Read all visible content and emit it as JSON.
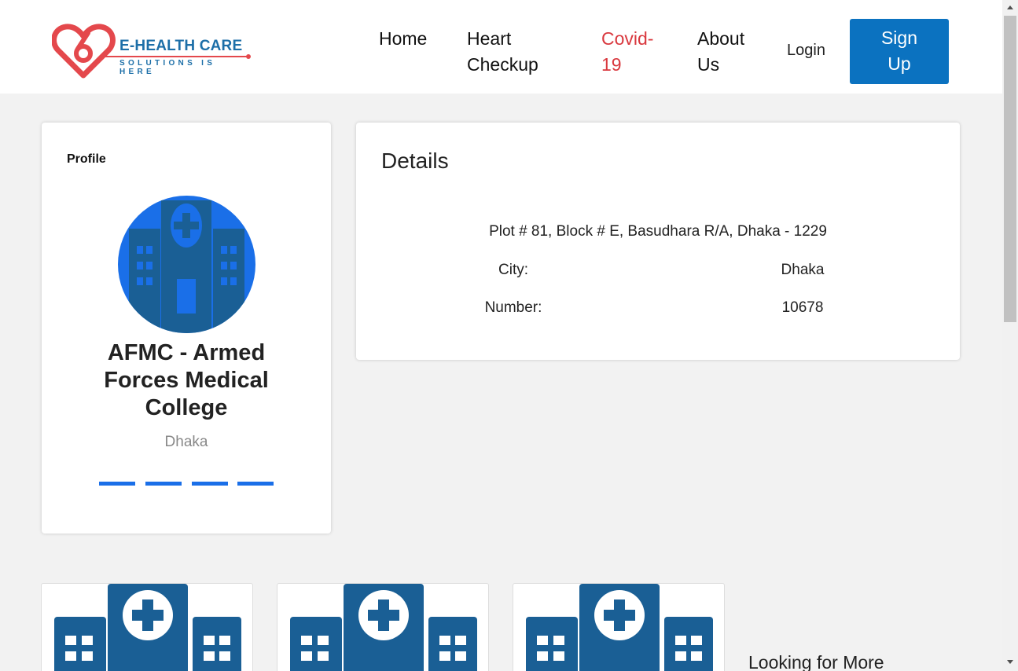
{
  "brand": {
    "name": "E-HEALTH CARE",
    "tagline": "SOLUTIONS IS HERE",
    "logo_color": "#e4484c",
    "text_color": "#1d6fa8"
  },
  "nav": {
    "home": "Home",
    "heart_checkup": "Heart Checkup",
    "covid": "Covid-19",
    "about": "About Us",
    "login": "Login",
    "signup": "Sign Up"
  },
  "profile": {
    "heading": "Profile",
    "icon": "hospital-icon",
    "name": "AFMC - Armed Forces Medical College",
    "city": "Dhaka",
    "social_links": [
      "social-link-1",
      "social-link-2",
      "social-link-3",
      "social-link-4"
    ]
  },
  "details": {
    "title": "Details",
    "address": "Plot # 81, Block # E, Basudhara R/A, Dhaka - 1229",
    "city_label": "City:",
    "city_value": "Dhaka",
    "number_label": "Number:",
    "number_value": "10678"
  },
  "more": {
    "heading": "Looking for More",
    "tiles": [
      "hospital-icon",
      "hospital-icon",
      "hospital-icon"
    ]
  },
  "colors": {
    "accent": "#0b72c0",
    "covid": "#d9383e",
    "avatar_bg": "#1a6fe8",
    "building": "#1a5f95"
  }
}
